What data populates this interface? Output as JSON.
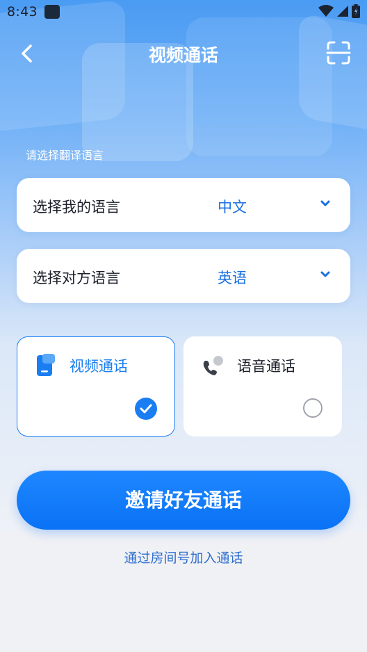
{
  "status_bar": {
    "time": "8:43",
    "icons": [
      "app-notification-icon",
      "wifi-icon",
      "cell-signal-icon",
      "battery-icon"
    ]
  },
  "header": {
    "title": "视频通话",
    "back_icon": "chevron-left-icon",
    "scan_icon": "scan-icon"
  },
  "language_section": {
    "label": "请选择翻译语言",
    "my_language": {
      "label": "选择我的语言",
      "value": "中文"
    },
    "peer_language": {
      "label": "选择对方语言",
      "value": "英语"
    }
  },
  "call_modes": {
    "video": {
      "label": "视频通话",
      "selected": true
    },
    "voice": {
      "label": "语音通话",
      "selected": false
    }
  },
  "actions": {
    "invite_label": "邀请好友通话",
    "room_link_label": "通过房间号加入通话"
  },
  "colors": {
    "accent": "#1a7ef2",
    "value_text": "#1a6fe0",
    "link": "#2f6fcf"
  }
}
